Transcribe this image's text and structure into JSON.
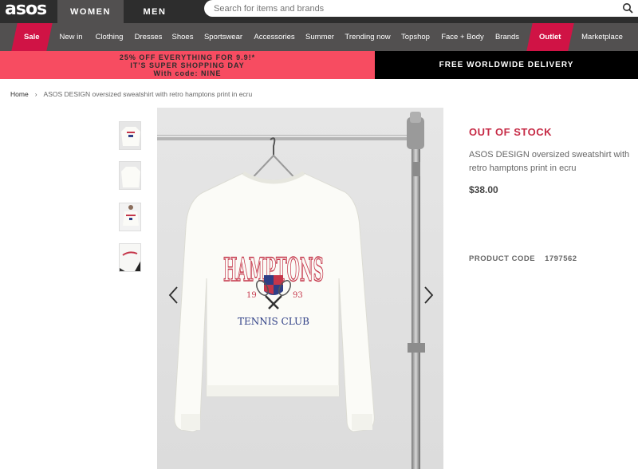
{
  "header": {
    "logo": "asos",
    "tabs": [
      "WOMEN",
      "MEN"
    ],
    "search_placeholder": "Search for items and brands"
  },
  "nav": {
    "items": [
      "Sale",
      "New in",
      "Clothing",
      "Dresses",
      "Shoes",
      "Sportswear",
      "Accessories",
      "Summer",
      "Trending now",
      "Topshop",
      "Face + Body",
      "Brands",
      "Outlet",
      "Marketplace"
    ]
  },
  "promo": {
    "line1": "25% OFF EVERYTHING FOR 9.9!*",
    "line2": "IT'S SUPER SHOPPING DAY",
    "line3": "With code: NINE",
    "delivery": "FREE WORLDWIDE DELIVERY"
  },
  "breadcrumb": {
    "home": "Home",
    "separator": "›",
    "current": "ASOS DESIGN oversized sweatshirt with retro hamptons print in ecru"
  },
  "product": {
    "status": "OUT OF STOCK",
    "name": "ASOS DESIGN oversized sweatshirt with retro hamptons print in ecru",
    "price": "$38.00",
    "code_label": "PRODUCT CODE",
    "code_value": "1797562"
  },
  "image_print": {
    "line1": "HAMPTONS",
    "year_left": "19",
    "year_right": "93",
    "line2": "TENNIS CLUB"
  },
  "colors": {
    "header": "#2d2d2d",
    "nav": "#525050",
    "sale": "#d01345",
    "promo": "#f74c61",
    "out_of_stock": "#c62a45",
    "print_red": "#c5364a",
    "print_navy": "#2f3f86"
  }
}
